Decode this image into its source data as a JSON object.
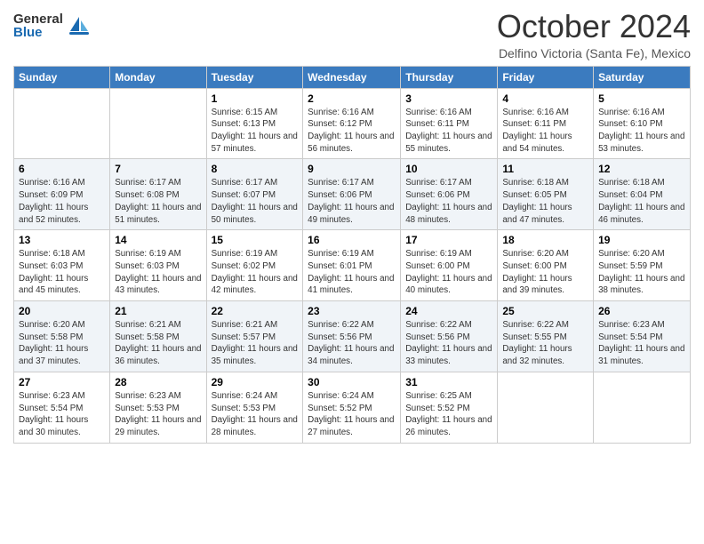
{
  "header": {
    "logo_general": "General",
    "logo_blue": "Blue",
    "month": "October 2024",
    "location": "Delfino Victoria (Santa Fe), Mexico"
  },
  "weekdays": [
    "Sunday",
    "Monday",
    "Tuesday",
    "Wednesday",
    "Thursday",
    "Friday",
    "Saturday"
  ],
  "weeks": [
    [
      null,
      null,
      {
        "day": 1,
        "sunrise": "6:15 AM",
        "sunset": "6:13 PM",
        "daylight": "11 hours and 57 minutes."
      },
      {
        "day": 2,
        "sunrise": "6:16 AM",
        "sunset": "6:12 PM",
        "daylight": "11 hours and 56 minutes."
      },
      {
        "day": 3,
        "sunrise": "6:16 AM",
        "sunset": "6:11 PM",
        "daylight": "11 hours and 55 minutes."
      },
      {
        "day": 4,
        "sunrise": "6:16 AM",
        "sunset": "6:11 PM",
        "daylight": "11 hours and 54 minutes."
      },
      {
        "day": 5,
        "sunrise": "6:16 AM",
        "sunset": "6:10 PM",
        "daylight": "11 hours and 53 minutes."
      }
    ],
    [
      {
        "day": 6,
        "sunrise": "6:16 AM",
        "sunset": "6:09 PM",
        "daylight": "11 hours and 52 minutes."
      },
      {
        "day": 7,
        "sunrise": "6:17 AM",
        "sunset": "6:08 PM",
        "daylight": "11 hours and 51 minutes."
      },
      {
        "day": 8,
        "sunrise": "6:17 AM",
        "sunset": "6:07 PM",
        "daylight": "11 hours and 50 minutes."
      },
      {
        "day": 9,
        "sunrise": "6:17 AM",
        "sunset": "6:06 PM",
        "daylight": "11 hours and 49 minutes."
      },
      {
        "day": 10,
        "sunrise": "6:17 AM",
        "sunset": "6:06 PM",
        "daylight": "11 hours and 48 minutes."
      },
      {
        "day": 11,
        "sunrise": "6:18 AM",
        "sunset": "6:05 PM",
        "daylight": "11 hours and 47 minutes."
      },
      {
        "day": 12,
        "sunrise": "6:18 AM",
        "sunset": "6:04 PM",
        "daylight": "11 hours and 46 minutes."
      }
    ],
    [
      {
        "day": 13,
        "sunrise": "6:18 AM",
        "sunset": "6:03 PM",
        "daylight": "11 hours and 45 minutes."
      },
      {
        "day": 14,
        "sunrise": "6:19 AM",
        "sunset": "6:03 PM",
        "daylight": "11 hours and 43 minutes."
      },
      {
        "day": 15,
        "sunrise": "6:19 AM",
        "sunset": "6:02 PM",
        "daylight": "11 hours and 42 minutes."
      },
      {
        "day": 16,
        "sunrise": "6:19 AM",
        "sunset": "6:01 PM",
        "daylight": "11 hours and 41 minutes."
      },
      {
        "day": 17,
        "sunrise": "6:19 AM",
        "sunset": "6:00 PM",
        "daylight": "11 hours and 40 minutes."
      },
      {
        "day": 18,
        "sunrise": "6:20 AM",
        "sunset": "6:00 PM",
        "daylight": "11 hours and 39 minutes."
      },
      {
        "day": 19,
        "sunrise": "6:20 AM",
        "sunset": "5:59 PM",
        "daylight": "11 hours and 38 minutes."
      }
    ],
    [
      {
        "day": 20,
        "sunrise": "6:20 AM",
        "sunset": "5:58 PM",
        "daylight": "11 hours and 37 minutes."
      },
      {
        "day": 21,
        "sunrise": "6:21 AM",
        "sunset": "5:58 PM",
        "daylight": "11 hours and 36 minutes."
      },
      {
        "day": 22,
        "sunrise": "6:21 AM",
        "sunset": "5:57 PM",
        "daylight": "11 hours and 35 minutes."
      },
      {
        "day": 23,
        "sunrise": "6:22 AM",
        "sunset": "5:56 PM",
        "daylight": "11 hours and 34 minutes."
      },
      {
        "day": 24,
        "sunrise": "6:22 AM",
        "sunset": "5:56 PM",
        "daylight": "11 hours and 33 minutes."
      },
      {
        "day": 25,
        "sunrise": "6:22 AM",
        "sunset": "5:55 PM",
        "daylight": "11 hours and 32 minutes."
      },
      {
        "day": 26,
        "sunrise": "6:23 AM",
        "sunset": "5:54 PM",
        "daylight": "11 hours and 31 minutes."
      }
    ],
    [
      {
        "day": 27,
        "sunrise": "6:23 AM",
        "sunset": "5:54 PM",
        "daylight": "11 hours and 30 minutes."
      },
      {
        "day": 28,
        "sunrise": "6:23 AM",
        "sunset": "5:53 PM",
        "daylight": "11 hours and 29 minutes."
      },
      {
        "day": 29,
        "sunrise": "6:24 AM",
        "sunset": "5:53 PM",
        "daylight": "11 hours and 28 minutes."
      },
      {
        "day": 30,
        "sunrise": "6:24 AM",
        "sunset": "5:52 PM",
        "daylight": "11 hours and 27 minutes."
      },
      {
        "day": 31,
        "sunrise": "6:25 AM",
        "sunset": "5:52 PM",
        "daylight": "11 hours and 26 minutes."
      },
      null,
      null
    ]
  ],
  "labels": {
    "sunrise": "Sunrise:",
    "sunset": "Sunset:",
    "daylight": "Daylight:"
  }
}
